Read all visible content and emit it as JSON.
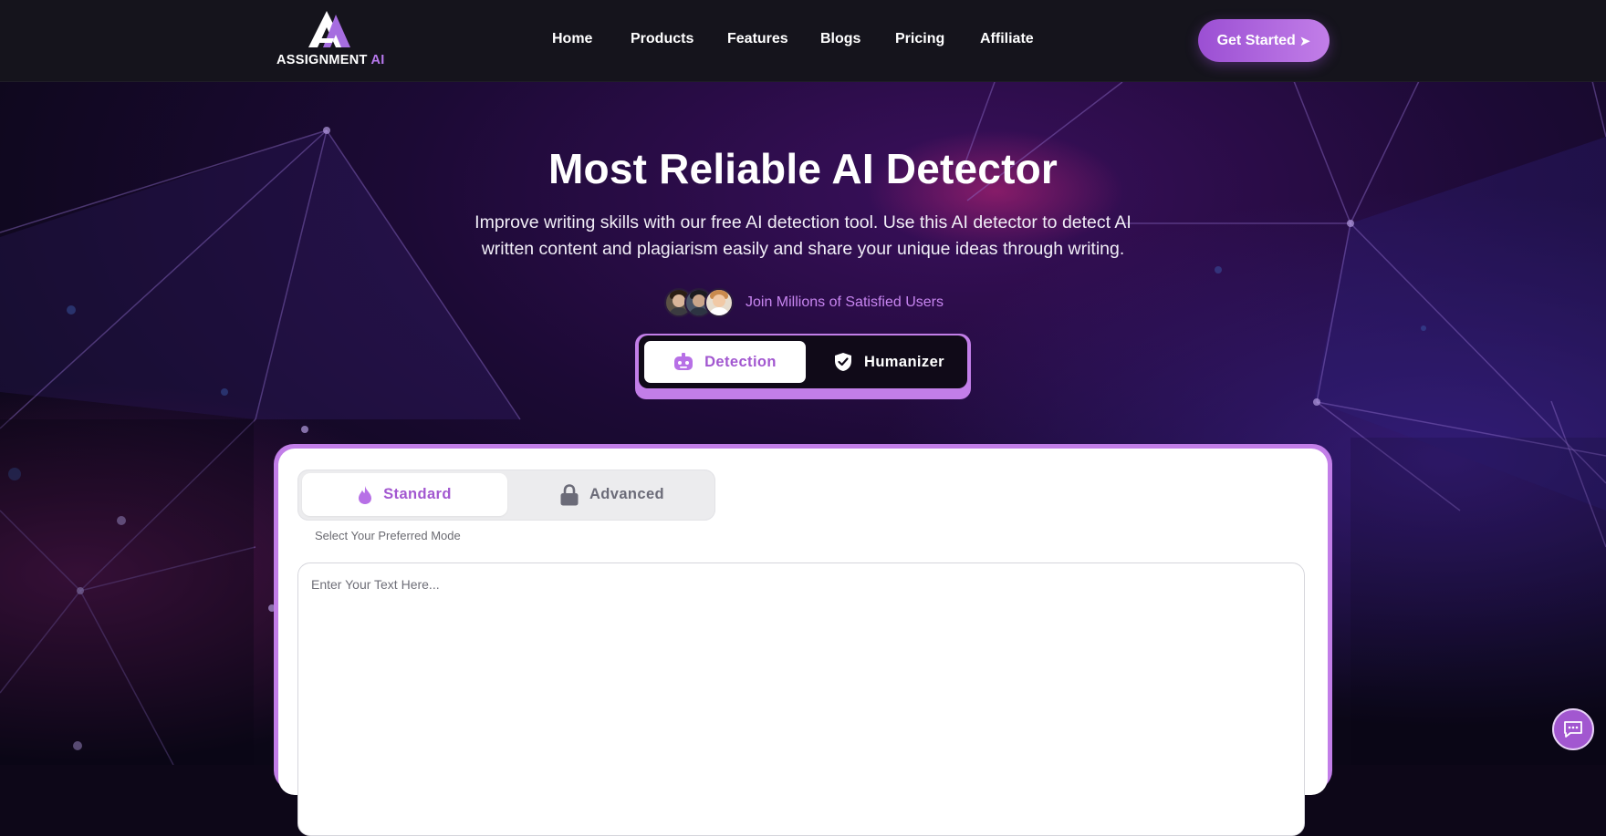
{
  "brand": {
    "name_main": "ASSIGNMENT",
    "name_accent": "AI",
    "accent_color": "#c27ee8",
    "primary_purple": "#a257d0"
  },
  "nav": {
    "links": [
      "Home",
      "Products",
      "Features",
      "Blogs",
      "Pricing",
      "Affiliate"
    ],
    "cta_label": "Get Started",
    "cta_icon": "send-arrow-icon"
  },
  "hero": {
    "title": "Most Reliable AI Detector",
    "subtitle_line1": "Improve writing skills with our free AI detection tool. Use this AI detector to detect AI",
    "subtitle_line2": "written content and plagiarism easily and share your unique ideas through writing.",
    "social_proof": "Join Millions of Satisfied Users"
  },
  "mode_switch": {
    "selected": "Detection",
    "tabs": [
      {
        "label": "Detection",
        "icon": "robot-icon"
      },
      {
        "label": "Humanizer",
        "icon": "shield-check-icon"
      }
    ]
  },
  "detector": {
    "selected_mode": "Standard",
    "modes": [
      {
        "label": "Standard",
        "icon": "flame-icon"
      },
      {
        "label": "Advanced",
        "icon": "lock-icon"
      }
    ],
    "mode_hint": "Select Your Preferred Mode",
    "input_placeholder": "Enter Your Text Here...",
    "input_value": ""
  },
  "chat_widget": {
    "icon": "chat-icon"
  }
}
